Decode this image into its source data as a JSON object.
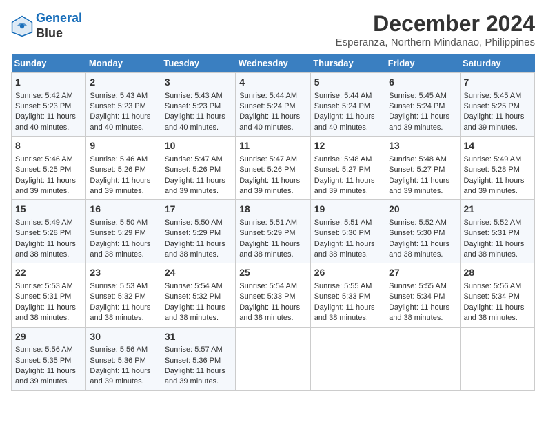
{
  "logo": {
    "line1": "General",
    "line2": "Blue"
  },
  "title": "December 2024",
  "subtitle": "Esperanza, Northern Mindanao, Philippines",
  "days_of_week": [
    "Sunday",
    "Monday",
    "Tuesday",
    "Wednesday",
    "Thursday",
    "Friday",
    "Saturday"
  ],
  "weeks": [
    [
      {
        "day": "1",
        "sunrise": "5:42 AM",
        "sunset": "5:23 PM",
        "daylight": "11 hours and 40 minutes."
      },
      {
        "day": "2",
        "sunrise": "5:43 AM",
        "sunset": "5:23 PM",
        "daylight": "11 hours and 40 minutes."
      },
      {
        "day": "3",
        "sunrise": "5:43 AM",
        "sunset": "5:23 PM",
        "daylight": "11 hours and 40 minutes."
      },
      {
        "day": "4",
        "sunrise": "5:44 AM",
        "sunset": "5:24 PM",
        "daylight": "11 hours and 40 minutes."
      },
      {
        "day": "5",
        "sunrise": "5:44 AM",
        "sunset": "5:24 PM",
        "daylight": "11 hours and 40 minutes."
      },
      {
        "day": "6",
        "sunrise": "5:45 AM",
        "sunset": "5:24 PM",
        "daylight": "11 hours and 39 minutes."
      },
      {
        "day": "7",
        "sunrise": "5:45 AM",
        "sunset": "5:25 PM",
        "daylight": "11 hours and 39 minutes."
      }
    ],
    [
      {
        "day": "8",
        "sunrise": "5:46 AM",
        "sunset": "5:25 PM",
        "daylight": "11 hours and 39 minutes."
      },
      {
        "day": "9",
        "sunrise": "5:46 AM",
        "sunset": "5:26 PM",
        "daylight": "11 hours and 39 minutes."
      },
      {
        "day": "10",
        "sunrise": "5:47 AM",
        "sunset": "5:26 PM",
        "daylight": "11 hours and 39 minutes."
      },
      {
        "day": "11",
        "sunrise": "5:47 AM",
        "sunset": "5:26 PM",
        "daylight": "11 hours and 39 minutes."
      },
      {
        "day": "12",
        "sunrise": "5:48 AM",
        "sunset": "5:27 PM",
        "daylight": "11 hours and 39 minutes."
      },
      {
        "day": "13",
        "sunrise": "5:48 AM",
        "sunset": "5:27 PM",
        "daylight": "11 hours and 39 minutes."
      },
      {
        "day": "14",
        "sunrise": "5:49 AM",
        "sunset": "5:28 PM",
        "daylight": "11 hours and 39 minutes."
      }
    ],
    [
      {
        "day": "15",
        "sunrise": "5:49 AM",
        "sunset": "5:28 PM",
        "daylight": "11 hours and 38 minutes."
      },
      {
        "day": "16",
        "sunrise": "5:50 AM",
        "sunset": "5:29 PM",
        "daylight": "11 hours and 38 minutes."
      },
      {
        "day": "17",
        "sunrise": "5:50 AM",
        "sunset": "5:29 PM",
        "daylight": "11 hours and 38 minutes."
      },
      {
        "day": "18",
        "sunrise": "5:51 AM",
        "sunset": "5:29 PM",
        "daylight": "11 hours and 38 minutes."
      },
      {
        "day": "19",
        "sunrise": "5:51 AM",
        "sunset": "5:30 PM",
        "daylight": "11 hours and 38 minutes."
      },
      {
        "day": "20",
        "sunrise": "5:52 AM",
        "sunset": "5:30 PM",
        "daylight": "11 hours and 38 minutes."
      },
      {
        "day": "21",
        "sunrise": "5:52 AM",
        "sunset": "5:31 PM",
        "daylight": "11 hours and 38 minutes."
      }
    ],
    [
      {
        "day": "22",
        "sunrise": "5:53 AM",
        "sunset": "5:31 PM",
        "daylight": "11 hours and 38 minutes."
      },
      {
        "day": "23",
        "sunrise": "5:53 AM",
        "sunset": "5:32 PM",
        "daylight": "11 hours and 38 minutes."
      },
      {
        "day": "24",
        "sunrise": "5:54 AM",
        "sunset": "5:32 PM",
        "daylight": "11 hours and 38 minutes."
      },
      {
        "day": "25",
        "sunrise": "5:54 AM",
        "sunset": "5:33 PM",
        "daylight": "11 hours and 38 minutes."
      },
      {
        "day": "26",
        "sunrise": "5:55 AM",
        "sunset": "5:33 PM",
        "daylight": "11 hours and 38 minutes."
      },
      {
        "day": "27",
        "sunrise": "5:55 AM",
        "sunset": "5:34 PM",
        "daylight": "11 hours and 38 minutes."
      },
      {
        "day": "28",
        "sunrise": "5:56 AM",
        "sunset": "5:34 PM",
        "daylight": "11 hours and 38 minutes."
      }
    ],
    [
      {
        "day": "29",
        "sunrise": "5:56 AM",
        "sunset": "5:35 PM",
        "daylight": "11 hours and 39 minutes."
      },
      {
        "day": "30",
        "sunrise": "5:56 AM",
        "sunset": "5:36 PM",
        "daylight": "11 hours and 39 minutes."
      },
      {
        "day": "31",
        "sunrise": "5:57 AM",
        "sunset": "5:36 PM",
        "daylight": "11 hours and 39 minutes."
      },
      null,
      null,
      null,
      null
    ]
  ],
  "labels": {
    "sunrise": "Sunrise: ",
    "sunset": "Sunset: ",
    "daylight": "Daylight: "
  }
}
